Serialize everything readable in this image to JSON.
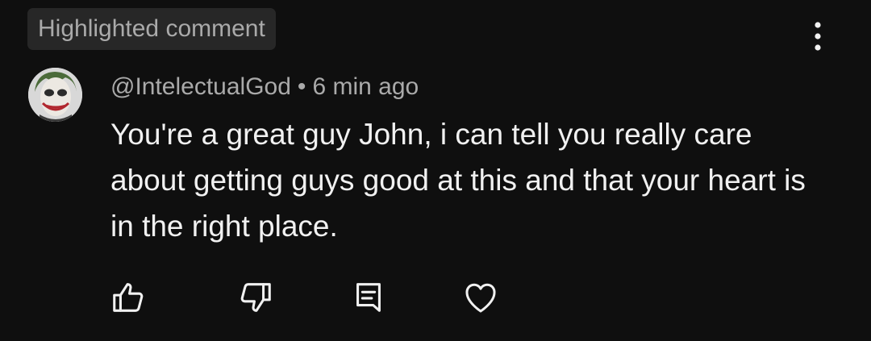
{
  "badge": {
    "label": "Highlighted comment"
  },
  "comment": {
    "author": "@IntelectualGod",
    "separator": "•",
    "timestamp": "6 min ago",
    "text": "You're a great guy John, i can tell you really care about getting guys good at this and that your heart is in the right place."
  },
  "actions": {
    "like": {
      "icon": "thumb-up-icon"
    },
    "dislike": {
      "icon": "thumb-down-icon"
    },
    "reply": {
      "icon": "reply-comment-icon"
    },
    "heart": {
      "icon": "heart-icon"
    }
  },
  "menu": {
    "icon": "more-vertical-icon"
  },
  "colors": {
    "background": "#0f0f0f",
    "badge_background": "#272727",
    "secondary_text": "#aaaaaa",
    "primary_text": "#f1f1f1"
  }
}
